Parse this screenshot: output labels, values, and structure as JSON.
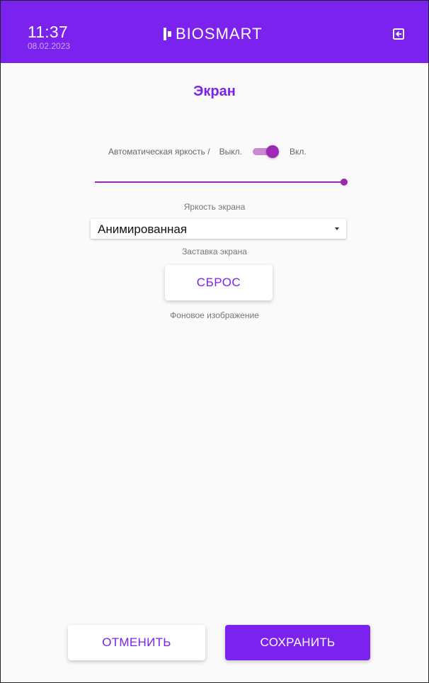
{
  "header": {
    "time": "11:37",
    "date": "08.02.2023",
    "logo_text": "BIOSMART",
    "logo_icon": "biosmart-logo-icon",
    "logout_icon": "logout-icon"
  },
  "page": {
    "title": "Экран"
  },
  "auto_brightness": {
    "label": "Автоматическая яркость /",
    "off_label": "Выкл.",
    "on_label": "Вкл.",
    "enabled": true
  },
  "brightness": {
    "caption": "Яркость экрана",
    "value_percent": 100
  },
  "screensaver": {
    "selected": "Анимированная",
    "caption": "Заставка экрана"
  },
  "background": {
    "reset_label": "СБРОС",
    "caption": "Фоновое изображение"
  },
  "actions": {
    "cancel_label": "ОТМЕНИТЬ",
    "save_label": "СОХРАНИТЬ"
  },
  "colors": {
    "accent": "#7b22ee",
    "switch_active": "#a127b5",
    "slider": "#9c27b0"
  }
}
